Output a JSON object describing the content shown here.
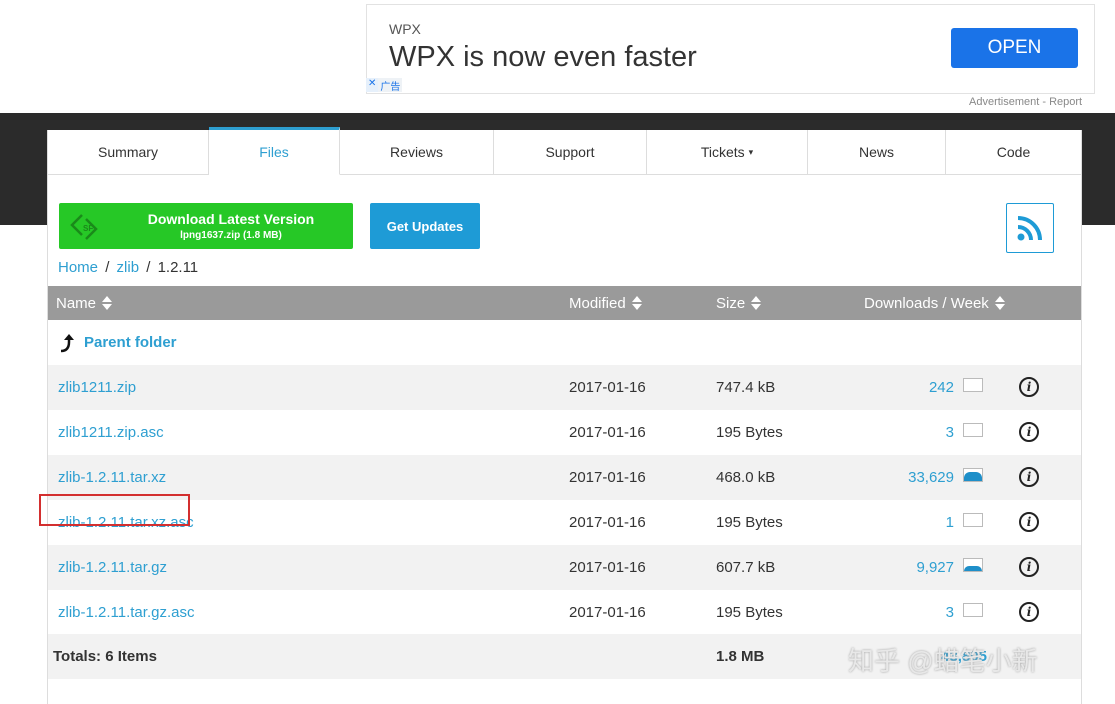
{
  "ad": {
    "brand": "WPX",
    "headline": "WPX is now even faster",
    "open_label": "OPEN",
    "adchoices_close": "✕",
    "adchoices_text": "广告",
    "report_text": "Advertisement - Report"
  },
  "tabs": [
    {
      "label": "Summary",
      "active": false
    },
    {
      "label": "Files",
      "active": true
    },
    {
      "label": "Reviews",
      "active": false
    },
    {
      "label": "Support",
      "active": false
    },
    {
      "label": "Tickets",
      "active": false
    },
    {
      "label": "News",
      "active": false
    },
    {
      "label": "Code",
      "active": false
    }
  ],
  "tickets_caret": "▾",
  "download": {
    "title": "Download Latest Version",
    "subtitle": "lpng1637.zip (1.8 MB)",
    "logo_text": "SF"
  },
  "updates_label": "Get Updates",
  "breadcrumb": {
    "home": "Home",
    "parent": "zlib",
    "current": "1.2.11",
    "separator": "/"
  },
  "table": {
    "headers": {
      "name": "Name",
      "modified": "Modified",
      "size": "Size",
      "downloads": "Downloads / Week"
    },
    "parent_folder": "Parent folder",
    "rows": [
      {
        "name": "zlib1211.zip",
        "modified": "2017-01-16",
        "size": "747.4 kB",
        "downloads": "242",
        "trend": 0
      },
      {
        "name": "zlib1211.zip.asc",
        "modified": "2017-01-16",
        "size": "195 Bytes",
        "downloads": "3",
        "trend": 0
      },
      {
        "name": "zlib-1.2.11.tar.xz",
        "modified": "2017-01-16",
        "size": "468.0 kB",
        "downloads": "33,629",
        "trend": 0.75
      },
      {
        "name": "zlib-1.2.11.tar.xz.asc",
        "modified": "2017-01-16",
        "size": "195 Bytes",
        "downloads": "1",
        "trend": 0
      },
      {
        "name": "zlib-1.2.11.tar.gz",
        "modified": "2017-01-16",
        "size": "607.7 kB",
        "downloads": "9,927",
        "trend": 0.4
      },
      {
        "name": "zlib-1.2.11.tar.gz.asc",
        "modified": "2017-01-16",
        "size": "195 Bytes",
        "downloads": "3",
        "trend": 0
      }
    ],
    "info_glyph": "i",
    "totals": {
      "label": "Totals: 6 Items",
      "size": "1.8 MB",
      "downloads": "43,805"
    }
  },
  "watermark": "知乎 @蜡笔小新",
  "colors": {
    "link": "#2e9fd1",
    "download_green": "#26c826",
    "updates_blue": "#1e9bd6",
    "header_gray": "#9a9a9a",
    "highlight_red": "#d32f2f"
  }
}
